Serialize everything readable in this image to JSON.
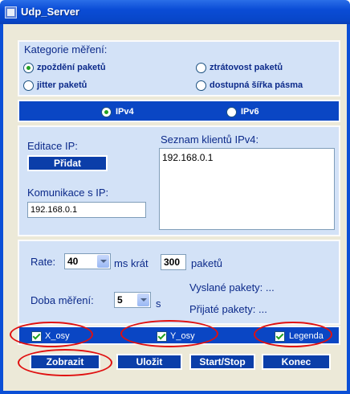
{
  "window": {
    "title": "Udp_Server"
  },
  "category": {
    "title": "Kategorie měření:",
    "options": [
      {
        "label": "zpoždění paketů",
        "checked": true
      },
      {
        "label": "ztrátovost paketů",
        "checked": false
      },
      {
        "label": "jitter paketů",
        "checked": false
      },
      {
        "label": "dostupná šířka pásma",
        "checked": false
      }
    ]
  },
  "ip_version": {
    "options": [
      {
        "label": "IPv4",
        "checked": true
      },
      {
        "label": "IPv6",
        "checked": false
      }
    ]
  },
  "ip_section": {
    "edit_label": "Editace IP:",
    "add_button": "Přidat",
    "comm_label": "Komunikace s IP:",
    "comm_value": "192.168.0.1",
    "client_list_label": "Seznam klientů IPv4:",
    "clients": [
      "192.168.0.1"
    ]
  },
  "rate_section": {
    "rate_label": "Rate:",
    "rate_value": "40",
    "ms_krat": "ms krát",
    "count_value": "300",
    "paketu": "paketů",
    "duration_label": "Doba měření:",
    "duration_value": "5",
    "duration_unit": "s",
    "sent_label": "Vyslané pakety: ...",
    "received_label": "Přijaté pakety: ..."
  },
  "checkboxes": [
    {
      "label": "X_osy",
      "checked": true
    },
    {
      "label": "Y_osy",
      "checked": true
    },
    {
      "label": "Legenda",
      "checked": true
    }
  ],
  "buttons": {
    "show": "Zobrazit",
    "save": "Uložit",
    "startstop": "Start/Stop",
    "end": "Konec"
  },
  "colors": {
    "accent": "#0a46c4",
    "panel": "#d3e2f7",
    "highlight": "#e01010"
  }
}
